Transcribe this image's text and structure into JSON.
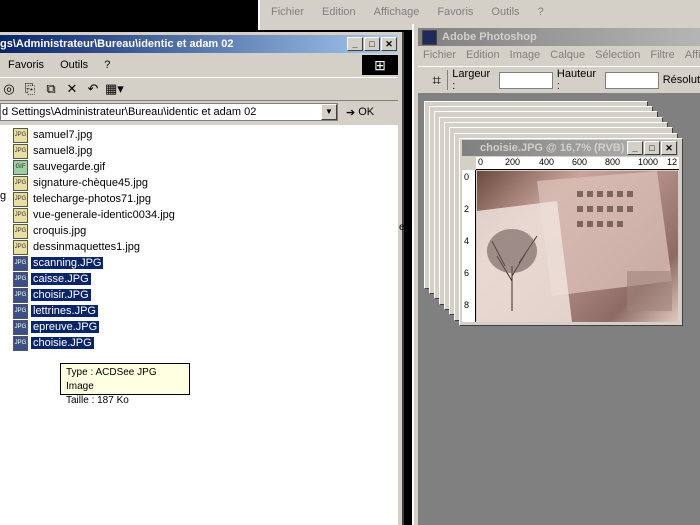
{
  "background_window": {
    "menu": [
      "Fichier",
      "Edition",
      "Affichage",
      "Favoris",
      "Outils",
      "?"
    ]
  },
  "photoshop": {
    "title": "Adobe Photoshop",
    "menu": [
      "Fichier",
      "Edition",
      "Image",
      "Calque",
      "Sélection",
      "Filtre",
      "Affich"
    ],
    "options": {
      "width_label": "Largeur :",
      "height_label": "Hauteur :",
      "resolution_label": "Résolut"
    },
    "document": {
      "title": "choisie.JPG @ 16,7% (RVB)",
      "ruler_top": [
        "0",
        "200",
        "400",
        "600",
        "800",
        "1000",
        "12"
      ],
      "ruler_left": [
        "0",
        "2",
        "4",
        "6",
        "8"
      ]
    }
  },
  "explorer": {
    "title": "gs\\Administrateur\\Bureau\\identic et adam 02",
    "menu": [
      "Favoris",
      "Outils",
      "?"
    ],
    "address": "d Settings\\Administrateur\\Bureau\\identic et adam 02",
    "go_label": "OK",
    "files": [
      {
        "name": "samuel7.jpg",
        "type": "JPG",
        "selected": false
      },
      {
        "name": "samuel8.jpg",
        "type": "JPG",
        "selected": false
      },
      {
        "name": "sauvegarde.gif",
        "type": "GIF",
        "selected": false
      },
      {
        "name": "signature-chèque45.jpg",
        "type": "JPG",
        "selected": false
      },
      {
        "name": "telecharge-photos71.jpg",
        "type": "JPG",
        "selected": false
      },
      {
        "name": "vue-generale-identic0034.jpg",
        "type": "JPG",
        "selected": false
      },
      {
        "name": "croquis.jpg",
        "type": "JPG",
        "selected": false
      },
      {
        "name": "dessinmaquettes1.jpg",
        "type": "JPG",
        "selected": false
      },
      {
        "name": "scanning.JPG",
        "type": "JPG",
        "selected": true
      },
      {
        "name": "caisse.JPG",
        "type": "JPG",
        "selected": true
      },
      {
        "name": "choisir.JPG",
        "type": "JPG",
        "selected": true
      },
      {
        "name": "lettrines.JPG",
        "type": "JPG",
        "selected": true
      },
      {
        "name": "epreuve.JPG",
        "type": "JPG",
        "selected": true
      },
      {
        "name": "choisie.JPG",
        "type": "JPG",
        "selected": true
      }
    ],
    "tooltip": {
      "type_line": "Type : ACDSee JPG Image",
      "size_line": "Taille : 187 Ko"
    },
    "left_cut_text": "g",
    "right_cut_text": "eu"
  },
  "colors": {
    "selection": "#0a246a",
    "active_title": "#0a246a",
    "inactive_title": "#808080",
    "tooltip_bg": "#ffffe1"
  }
}
